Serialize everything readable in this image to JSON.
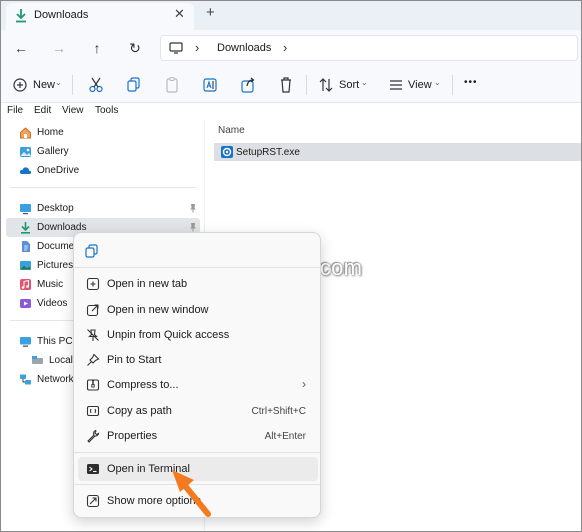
{
  "window": {
    "tab_title": "Downloads",
    "tab_close": "✕",
    "new_tab": "+"
  },
  "navigation": {
    "back": "←",
    "forward": "→",
    "up": "↑",
    "refresh": "↻"
  },
  "address": {
    "separator": "›",
    "location": "Downloads"
  },
  "commands": {
    "new_label": "New",
    "sort_label": "Sort",
    "view_label": "View",
    "more_label": "•••",
    "dropdown_glyph": "⌄"
  },
  "menu": [
    "File",
    "Edit",
    "View",
    "Tools"
  ],
  "nav": {
    "home": "Home",
    "gallery": "Gallery",
    "onedrive": "OneDrive",
    "desktop": "Desktop",
    "downloads": "Downloads",
    "documents": "Docume",
    "pictures": "Pictures",
    "music": "Music",
    "videos": "Videos",
    "this_pc": "This PC",
    "local_disk": "Local D",
    "network": "Network"
  },
  "files": {
    "column_name": "Name",
    "items": [
      {
        "name": "SetupRST.exe"
      }
    ]
  },
  "context_menu": {
    "items": [
      {
        "label": "Open in new tab"
      },
      {
        "label": "Open in new window"
      },
      {
        "label": "Unpin from Quick access"
      },
      {
        "label": "Pin to Start"
      },
      {
        "label": "Compress to...",
        "submenu": "›"
      },
      {
        "label": "Copy as path",
        "shortcut": "Ctrl+Shift+C"
      },
      {
        "label": "Properties",
        "shortcut": "Alt+Enter"
      },
      {
        "label": "Open in Terminal"
      },
      {
        "label": "Show more options"
      }
    ]
  },
  "watermark": "RepairWin.com",
  "colors": {
    "accent": "#1a73c9",
    "download_green": "#1d9a6c",
    "folder_yellow": "#f2c24a",
    "arrow_orange": "#f47a20",
    "selection_bg": "#dcdfe3"
  }
}
